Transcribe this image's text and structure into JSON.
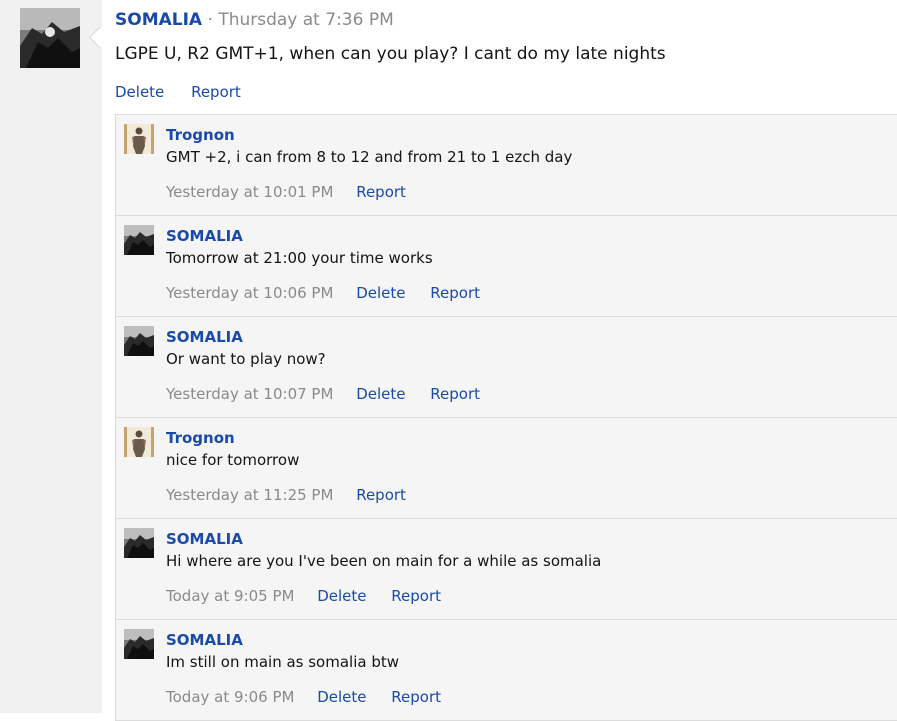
{
  "post": {
    "author": "SOMALIA",
    "separator": "·",
    "timestamp": "Thursday at 7:36 PM",
    "body": "LGPE U, R2 GMT+1, when can you play? I cant do my late nights",
    "actions": {
      "delete": "Delete",
      "report": "Report"
    }
  },
  "comments": [
    {
      "author": "Trognon",
      "text": "GMT +2, i can from 8 to 12 and from 21 to 1 ezch day",
      "time": "Yesterday at 10:01 PM",
      "delete": "",
      "report": "Report",
      "avatar": "trognon"
    },
    {
      "author": "SOMALIA",
      "text": "Tomorrow at 21:00 your time works",
      "time": "Yesterday at 10:06 PM",
      "delete": "Delete",
      "report": "Report",
      "avatar": "somalia"
    },
    {
      "author": "SOMALIA",
      "text": "Or want to play now?",
      "time": "Yesterday at 10:07 PM",
      "delete": "Delete",
      "report": "Report",
      "avatar": "somalia"
    },
    {
      "author": "Trognon",
      "text": "nice for tomorrow",
      "time": "Yesterday at 11:25 PM",
      "delete": "",
      "report": "Report",
      "avatar": "trognon"
    },
    {
      "author": "SOMALIA",
      "text": "Hi where are you I've been on main for a while as somalia",
      "time": "Today at 9:05 PM",
      "delete": "Delete",
      "report": "Report",
      "avatar": "somalia"
    },
    {
      "author": "SOMALIA",
      "text": "Im still on main as somalia btw",
      "time": "Today at 9:06 PM",
      "delete": "Delete",
      "report": "Report",
      "avatar": "somalia"
    }
  ],
  "colors": {
    "link": "#1a4aa8",
    "meta": "#8a8a8a",
    "comment_bg": "#f5f5f5",
    "gutter": "#f1f1f1"
  }
}
